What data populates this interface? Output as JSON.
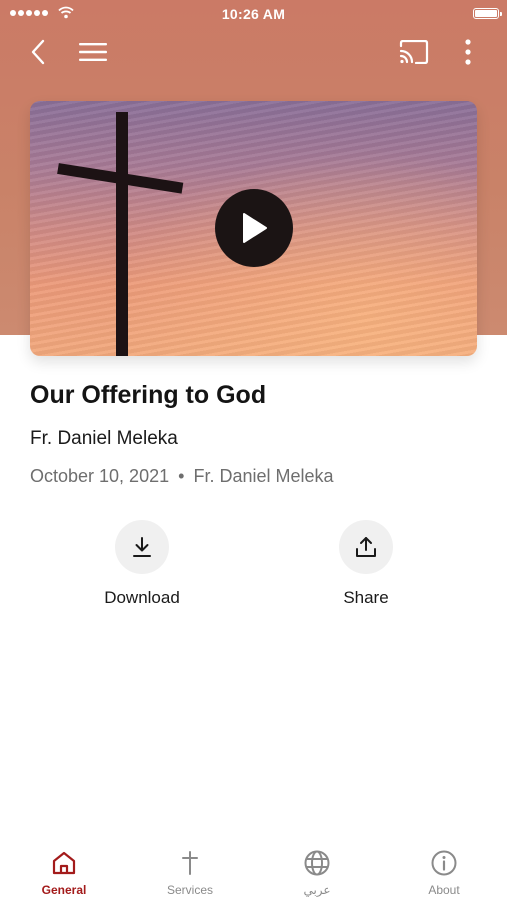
{
  "status_bar": {
    "time": "10:26 AM"
  },
  "episode": {
    "title": "Our Offering to God",
    "speaker": "Fr. Daniel Meleka",
    "date": "October 10, 2021",
    "separator": "•",
    "byline": "Fr. Daniel Meleka"
  },
  "actions": {
    "download_label": "Download",
    "share_label": "Share"
  },
  "tabs": [
    {
      "label": "General",
      "icon": "home-icon",
      "active": true
    },
    {
      "label": "Services",
      "icon": "cross-icon",
      "active": false
    },
    {
      "label": "عربي",
      "icon": "globe-icon",
      "active": false
    },
    {
      "label": "About",
      "icon": "info-icon",
      "active": false
    }
  ],
  "colors": {
    "header_bg": "#cb7a66",
    "active_tab": "#a31b1b",
    "inactive_tab": "#8a8a8a"
  }
}
